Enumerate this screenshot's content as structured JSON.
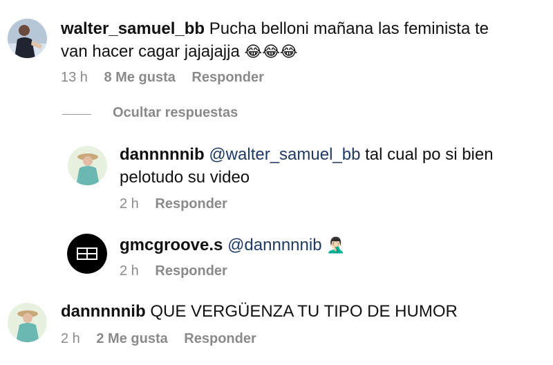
{
  "comments": [
    {
      "username": "walter_samuel_bb",
      "text": "Pucha belloni mañana las feminista te",
      "text2": "van hacer cagar jajajajja",
      "emoji": "😂😂😂",
      "time": "13 h",
      "likes": "8 Me gusta",
      "reply": "Responder"
    },
    {
      "username": "dannnnnib",
      "mention": "@walter_samuel_bb",
      "text": "tal cual po si bien",
      "text2": "pelotudo su video",
      "time": "2 h",
      "reply": "Responder"
    },
    {
      "username": "gmcgroove.s",
      "mention": "@dannnnnib",
      "emoji": "🤦🏻‍♂️",
      "time": "2 h",
      "reply": "Responder"
    },
    {
      "username": "dannnnnib",
      "text": "QUE VERGÜENZA TU TIPO DE HUMOR",
      "time": "2 h",
      "likes": "2 Me gusta",
      "reply": "Responder"
    }
  ],
  "hide_replies": "Ocultar respuestas"
}
